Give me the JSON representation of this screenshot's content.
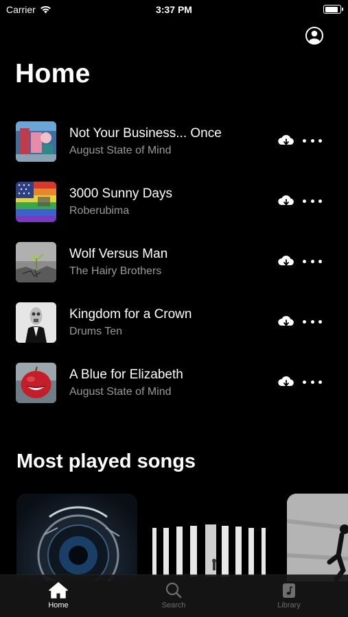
{
  "status": {
    "carrier": "Carrier",
    "time": "3:37 PM"
  },
  "header": {
    "title": "Home"
  },
  "songs": [
    {
      "title": "Not Your Business... Once",
      "artist": "August State of Mind"
    },
    {
      "title": "3000 Sunny Days",
      "artist": "Roberubima"
    },
    {
      "title": "Wolf Versus Man",
      "artist": "The Hairy Brothers"
    },
    {
      "title": "Kingdom for a Crown",
      "artist": "Drums Ten"
    },
    {
      "title": "A Blue for Elizabeth",
      "artist": "August State of Mind"
    }
  ],
  "most_played": {
    "title": "Most played songs"
  },
  "tabs": [
    {
      "label": "Home",
      "icon": "house-icon",
      "active": true
    },
    {
      "label": "Search",
      "icon": "magnifier-icon",
      "active": false
    },
    {
      "label": "Library",
      "icon": "music-note-icon",
      "active": false
    }
  ],
  "colors": {
    "background": "#000000",
    "text": "#ffffff",
    "secondary_text": "#9a9a9a",
    "tab_inactive": "#6e6e6e",
    "tab_bar": "#161616"
  }
}
